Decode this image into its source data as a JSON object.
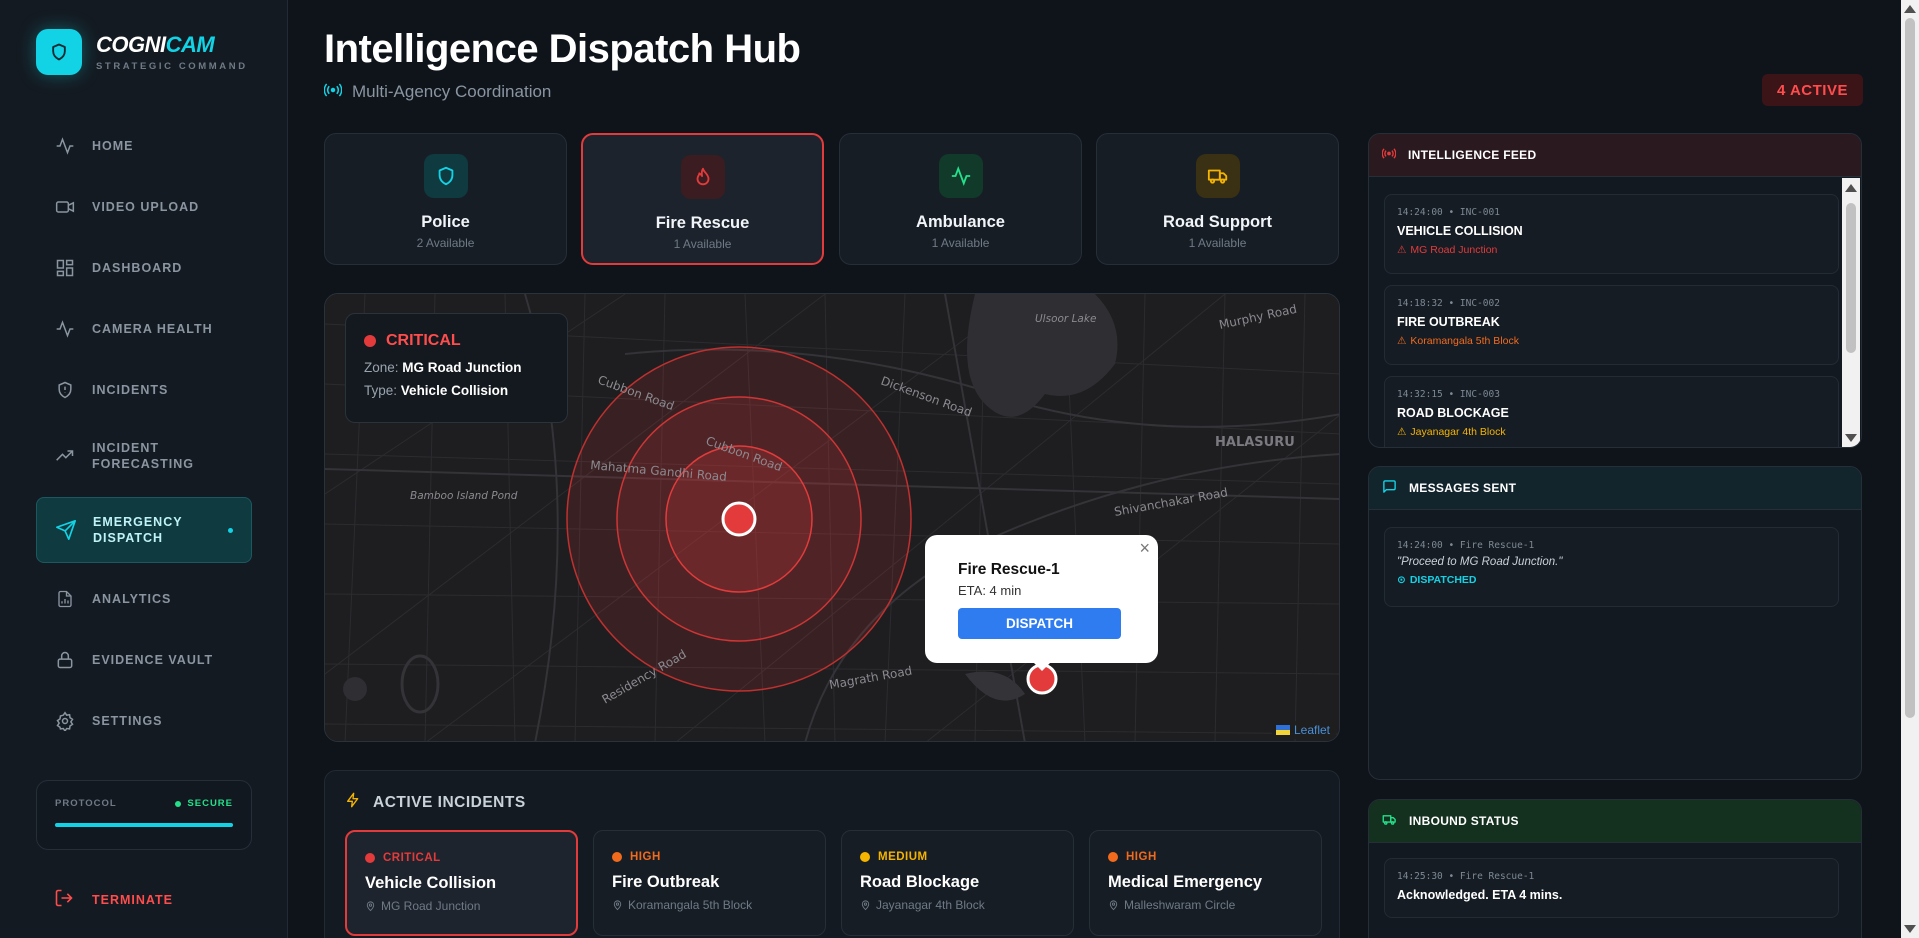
{
  "brand": {
    "name_part1": "COGNI",
    "name_part2": "CAM",
    "subtitle": "STRATEGIC COMMAND"
  },
  "sidebar": {
    "items": [
      {
        "label": "HOME",
        "icon": "pulse-icon"
      },
      {
        "label": "VIDEO UPLOAD",
        "icon": "video-icon"
      },
      {
        "label": "DASHBOARD",
        "icon": "dashboard-icon"
      },
      {
        "label": "CAMERA HEALTH",
        "icon": "pulse-icon"
      },
      {
        "label": "INCIDENTS",
        "icon": "shield-alert-icon"
      },
      {
        "label": "INCIDENT FORECASTING",
        "icon": "trend-icon"
      },
      {
        "label": "EMERGENCY DISPATCH",
        "icon": "send-icon",
        "active": true
      },
      {
        "label": "ANALYTICS",
        "icon": "report-icon"
      },
      {
        "label": "EVIDENCE VAULT",
        "icon": "lock-icon"
      },
      {
        "label": "SETTINGS",
        "icon": "gear-icon"
      }
    ],
    "protocol": {
      "label": "PROTOCOL",
      "status": "SECURE"
    },
    "terminate_label": "TERMINATE"
  },
  "header": {
    "title": "Intelligence Dispatch Hub",
    "subtitle": "Multi-Agency Coordination",
    "active_badge": "4 ACTIVE"
  },
  "agencies": [
    {
      "name": "Police",
      "available": "2 Available",
      "icon": "shield-icon",
      "color": "#12d3e6"
    },
    {
      "name": "Fire Rescue",
      "available": "1 Available",
      "icon": "flame-icon",
      "color": "#e33b3b",
      "selected": true
    },
    {
      "name": "Ambulance",
      "available": "1 Available",
      "icon": "pulse-icon",
      "color": "#24e08a"
    },
    {
      "name": "Road Support",
      "available": "1 Available",
      "icon": "truck-icon",
      "color": "#f5b400"
    }
  ],
  "map": {
    "info": {
      "severity": "CRITICAL",
      "zone_label": "Zone:",
      "zone": "MG Road Junction",
      "type_label": "Type:",
      "type": "Vehicle Collision"
    },
    "labels": {
      "cubbon_road": "Cubbon Road",
      "cubbon_road_inner": "Cubbon Road",
      "mahatma_gandhi_road": "Mahatma Gandhi Road",
      "dickenson_road": "Dickenson Road",
      "halasuru": "HALASURU",
      "bamboo_island_pond": "Bamboo Island Pond",
      "murphy_road": "Murphy Road",
      "residency_road": "Residency Road",
      "magrath_road": "Magrath Road",
      "shoolay_road": "Shivanchakar Road",
      "ulsoor": "Ulsoor Lake"
    },
    "popup": {
      "title": "Fire Rescue-1",
      "eta": "ETA: 4 min",
      "button": "DISPATCH",
      "close": "×"
    },
    "attribution": "Leaflet"
  },
  "incidents": {
    "header": "ACTIVE INCIDENTS",
    "items": [
      {
        "severity": "CRITICAL",
        "title": "Vehicle Collision",
        "location": "MG Road Junction",
        "color": "#e33b3b",
        "selected": true
      },
      {
        "severity": "HIGH",
        "title": "Fire Outbreak",
        "location": "Koramangala 5th Block",
        "color": "#f26b1d"
      },
      {
        "severity": "MEDIUM",
        "title": "Road Blockage",
        "location": "Jayanagar 4th Block",
        "color": "#f5b400"
      },
      {
        "severity": "HIGH",
        "title": "Medical Emergency",
        "location": "Malleshwaram Circle",
        "color": "#f26b1d"
      }
    ]
  },
  "intel_feed": {
    "header": "INTELLIGENCE FEED",
    "items": [
      {
        "meta": "14:24:00 • INC-001",
        "title": "VEHICLE COLLISION",
        "location": "MG Road Junction",
        "color": "#e33b3b"
      },
      {
        "meta": "14:18:32 • INC-002",
        "title": "FIRE OUTBREAK",
        "location": "Koramangala 5th Block",
        "color": "#f26b1d"
      },
      {
        "meta": "14:32:15 • INC-003",
        "title": "ROAD BLOCKAGE",
        "location": "Jayanagar 4th Block",
        "color": "#f5b400"
      }
    ]
  },
  "messages": {
    "header": "MESSAGES SENT",
    "items": [
      {
        "meta": "14:24:00 • Fire Rescue-1",
        "text": "\"Proceed to MG Road Junction.\"",
        "status": "DISPATCHED"
      }
    ]
  },
  "inbound": {
    "header": "INBOUND STATUS",
    "items": [
      {
        "meta": "14:25:30 • Fire Rescue-1",
        "text": "Acknowledged. ETA 4 mins."
      }
    ]
  }
}
